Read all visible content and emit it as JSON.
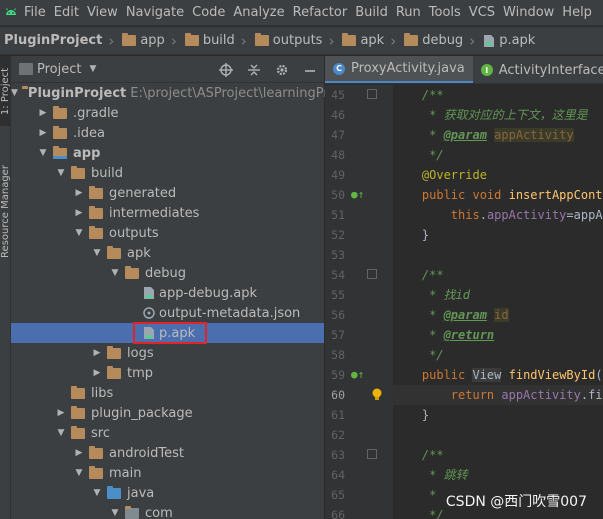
{
  "menubar": {
    "items": [
      "File",
      "Edit",
      "View",
      "Navigate",
      "Code",
      "Analyze",
      "Refactor",
      "Build",
      "Run",
      "Tools",
      "VCS",
      "Window",
      "Help"
    ]
  },
  "breadcrumb": {
    "items": [
      "PluginProject",
      "app",
      "build",
      "outputs",
      "apk",
      "debug",
      "p.apk"
    ]
  },
  "side_tabs": {
    "project": "1: Project",
    "resource_manager": "Resource Manager"
  },
  "project_panel": {
    "title": "Project",
    "view_dropdown": "▼",
    "tree": [
      {
        "label": "PluginProject",
        "detail": "E:\\project\\ASProject\\learningProject",
        "depth": 0,
        "arrow": "▼",
        "type": "module",
        "bold": true
      },
      {
        "label": ".gradle",
        "depth": 1,
        "arrow": "▶",
        "type": "folder"
      },
      {
        "label": ".idea",
        "depth": 1,
        "arrow": "▶",
        "type": "folder"
      },
      {
        "label": "app",
        "depth": 1,
        "arrow": "▼",
        "type": "module",
        "bold": true
      },
      {
        "label": "build",
        "depth": 2,
        "arrow": "▼",
        "type": "folder"
      },
      {
        "label": "generated",
        "depth": 3,
        "arrow": "▶",
        "type": "folder"
      },
      {
        "label": "intermediates",
        "depth": 3,
        "arrow": "▶",
        "type": "folder"
      },
      {
        "label": "outputs",
        "depth": 3,
        "arrow": "▼",
        "type": "folder"
      },
      {
        "label": "apk",
        "depth": 4,
        "arrow": "▼",
        "type": "folder"
      },
      {
        "label": "debug",
        "depth": 5,
        "arrow": "▼",
        "type": "folder"
      },
      {
        "label": "app-debug.apk",
        "depth": 6,
        "arrow": "",
        "type": "apk"
      },
      {
        "label": "output-metadata.json",
        "depth": 6,
        "arrow": "",
        "type": "json"
      },
      {
        "label": "p.apk",
        "depth": 6,
        "arrow": "",
        "type": "apk",
        "selected": true
      },
      {
        "label": "logs",
        "depth": 4,
        "arrow": "▶",
        "type": "folder"
      },
      {
        "label": "tmp",
        "depth": 4,
        "arrow": "▶",
        "type": "folder"
      },
      {
        "label": "libs",
        "depth": 2,
        "arrow": "",
        "type": "folder"
      },
      {
        "label": "plugin_package",
        "depth": 2,
        "arrow": "▶",
        "type": "folder"
      },
      {
        "label": "src",
        "depth": 2,
        "arrow": "▼",
        "type": "folder"
      },
      {
        "label": "androidTest",
        "depth": 3,
        "arrow": "▶",
        "type": "folder"
      },
      {
        "label": "main",
        "depth": 3,
        "arrow": "▼",
        "type": "folder"
      },
      {
        "label": "java",
        "depth": 4,
        "arrow": "▼",
        "type": "folder-blue"
      },
      {
        "label": "com",
        "depth": 5,
        "arrow": "▼",
        "type": "package"
      }
    ]
  },
  "editor": {
    "tabs": [
      {
        "label": "ProxyActivity.java",
        "icon": "C",
        "active": true
      },
      {
        "label": "ActivityInterface.java",
        "icon": "I",
        "active": false
      }
    ],
    "lines": [
      {
        "num": "45",
        "parts": [
          [
            "c-com",
            "    /**"
          ]
        ]
      },
      {
        "num": "46",
        "parts": [
          [
            "c-com",
            "     * 获取对应的上下文，这里是"
          ]
        ]
      },
      {
        "num": "47",
        "parts": [
          [
            "c-com",
            "     * "
          ],
          [
            "c-tag",
            "@param"
          ],
          [
            "c-com",
            " "
          ],
          [
            "c-param",
            "appActivity"
          ]
        ]
      },
      {
        "num": "48",
        "parts": [
          [
            "c-com",
            "     */"
          ]
        ]
      },
      {
        "num": "49",
        "parts": [
          [
            "c-ann",
            "    @Override"
          ]
        ]
      },
      {
        "num": "50",
        "parts": [
          [
            "c-kw",
            "    public void "
          ],
          [
            "c-fn",
            "insertAppConte"
          ]
        ]
      },
      {
        "num": "51",
        "parts": [
          [
            "c-kw",
            "        this"
          ],
          [
            "c-txt",
            "."
          ],
          [
            "c-field",
            "appActivity"
          ],
          [
            "c-txt",
            "=appA"
          ]
        ]
      },
      {
        "num": "52",
        "parts": [
          [
            "c-txt",
            "    }"
          ]
        ]
      },
      {
        "num": "53",
        "parts": [
          [
            "c-txt",
            ""
          ]
        ]
      },
      {
        "num": "54",
        "parts": [
          [
            "c-com",
            "    /**"
          ]
        ]
      },
      {
        "num": "55",
        "parts": [
          [
            "c-com",
            "     * 找id"
          ]
        ]
      },
      {
        "num": "56",
        "parts": [
          [
            "c-com",
            "     * "
          ],
          [
            "c-tag",
            "@param"
          ],
          [
            "c-com",
            " "
          ],
          [
            "c-param",
            "id"
          ]
        ]
      },
      {
        "num": "57",
        "parts": [
          [
            "c-com",
            "     * "
          ],
          [
            "c-tag",
            "@return"
          ]
        ]
      },
      {
        "num": "58",
        "parts": [
          [
            "c-com",
            "     */"
          ]
        ]
      },
      {
        "num": "59",
        "parts": [
          [
            "c-kw",
            "    public "
          ],
          [
            "c-type",
            "View"
          ],
          [
            "c-txt",
            " "
          ],
          [
            "c-fn",
            "findViewById"
          ],
          [
            "c-txt",
            "("
          ]
        ]
      },
      {
        "num": "60",
        "parts": [
          [
            "c-kw",
            "        return "
          ],
          [
            "c-field",
            "appActivity"
          ],
          [
            "c-txt",
            ".fin"
          ]
        ],
        "current": true
      },
      {
        "num": "61",
        "parts": [
          [
            "c-txt",
            "    }"
          ]
        ]
      },
      {
        "num": "62",
        "parts": [
          [
            "c-txt",
            ""
          ]
        ]
      },
      {
        "num": "63",
        "parts": [
          [
            "c-com",
            "    /**"
          ]
        ]
      },
      {
        "num": "64",
        "parts": [
          [
            "c-com",
            "     * 跳转"
          ]
        ]
      },
      {
        "num": "65",
        "parts": [
          [
            "c-com",
            "     * "
          ]
        ]
      },
      {
        "num": "66",
        "parts": [
          [
            "c-com",
            "     */"
          ]
        ]
      }
    ]
  },
  "watermark": "CSDN @西门吹雪007",
  "colors": {
    "selection": "#4b6eaf",
    "highlight_border": "#e0242a",
    "folder": "#b58b5b",
    "source_folder": "#4a8fc7",
    "android_green": "#3ddc84"
  }
}
